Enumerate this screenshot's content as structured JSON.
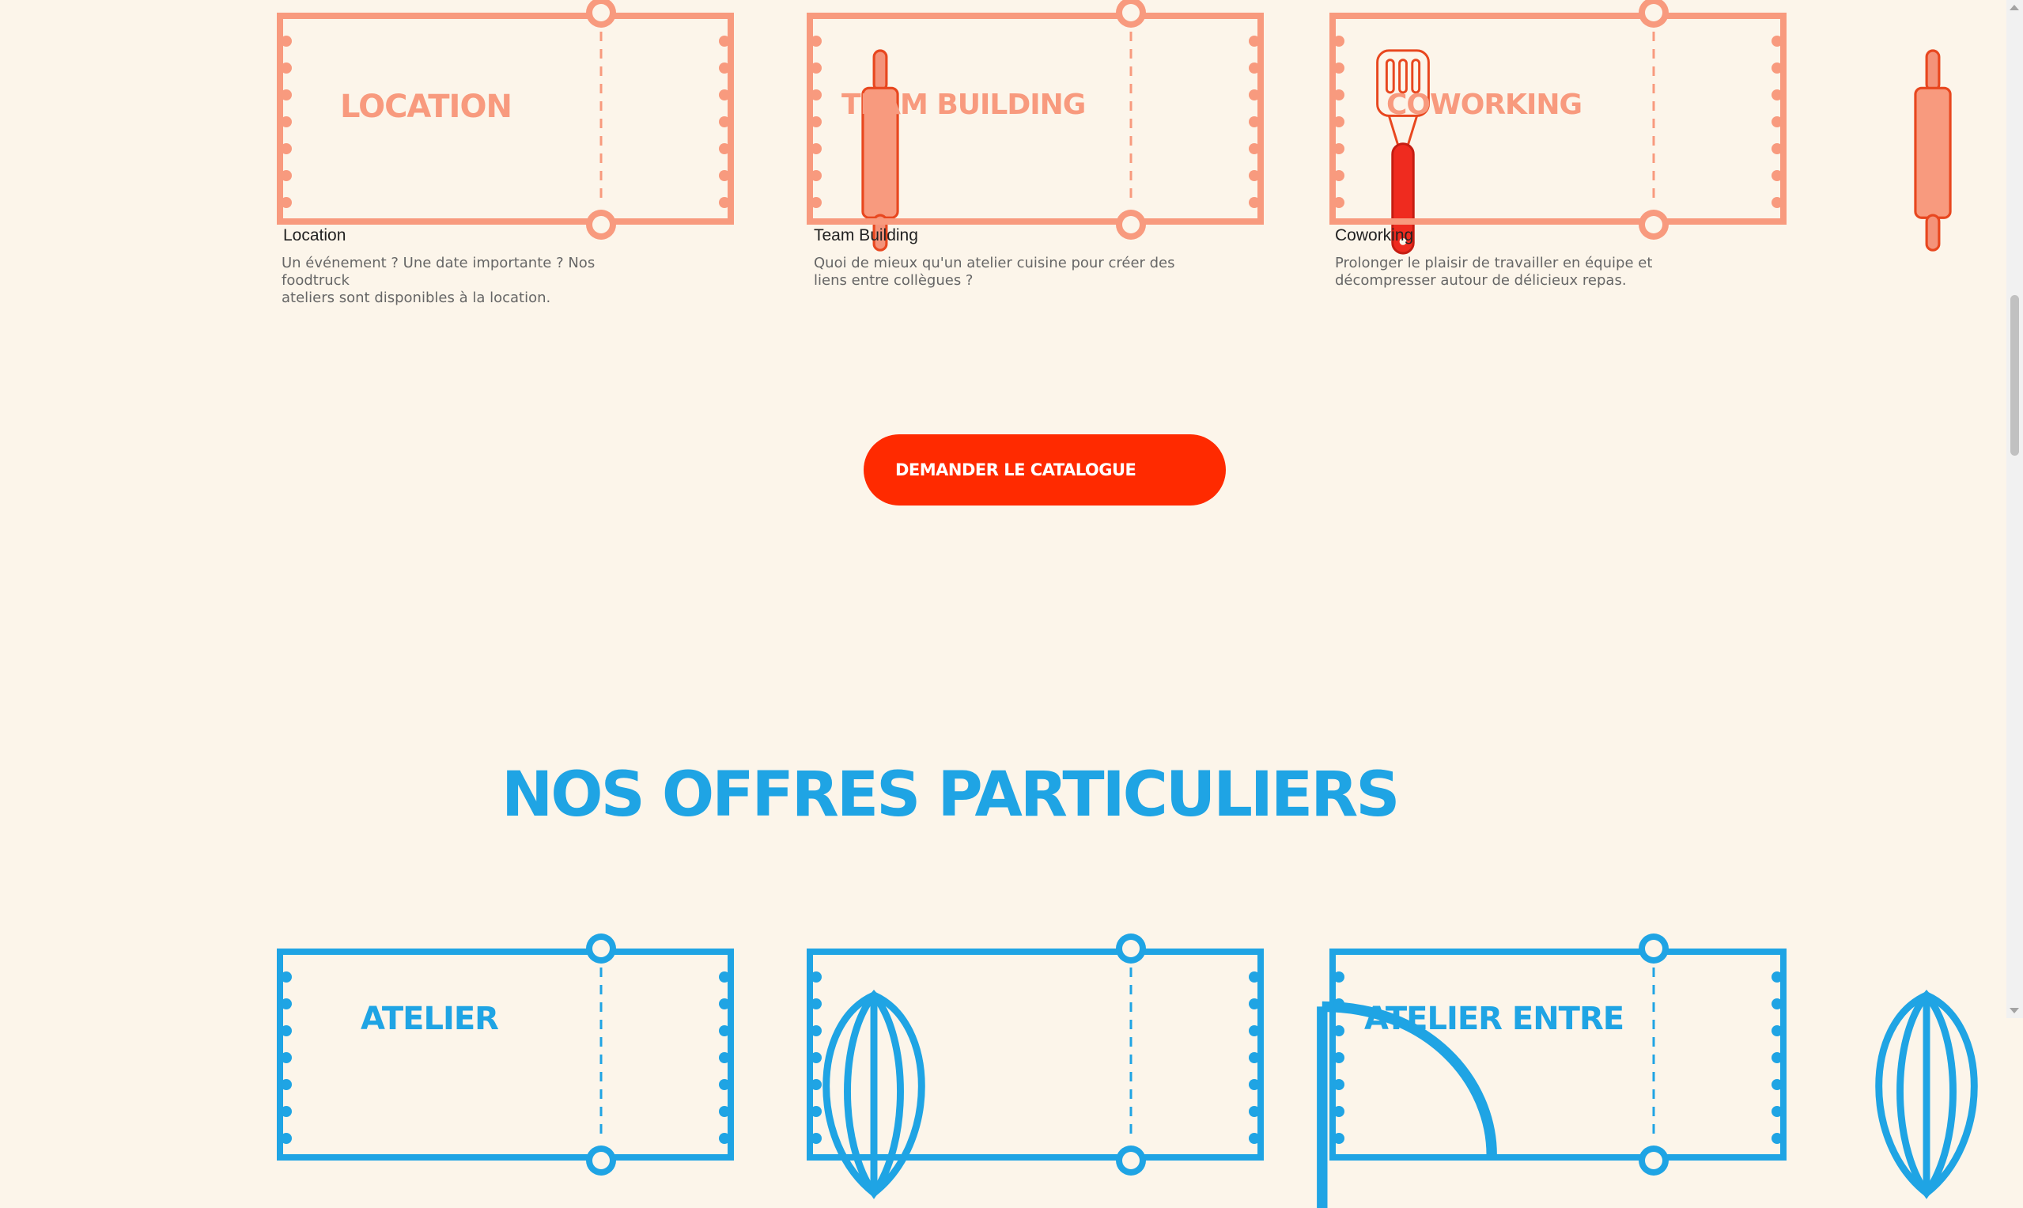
{
  "colors": {
    "salmon": "#f89a7e",
    "red": "#ff2a00",
    "blue": "#1fa4e4",
    "background": "#fcf5ea"
  },
  "pro_cards": [
    {
      "ticket_label": "LOCATION",
      "title": "Location",
      "desc_line1": "Un événement ? Une date importante ? Nos foodtruck",
      "desc_line2": "ateliers sont disponibles à la location.",
      "icon": "rolling-pin-icon"
    },
    {
      "ticket_label": "TEAM BUILDING",
      "title": "Team Building",
      "desc_line1": "Quoi de mieux qu'un atelier cuisine pour créer des",
      "desc_line2": "liens entre collègues ?",
      "icon": "spatula-icon"
    },
    {
      "ticket_label": "COWORKING",
      "title": "Coworking",
      "desc_line1": "Prolonger le plaisir de travailler en équipe et",
      "desc_line2": "décompresser autour de délicieux repas.",
      "icon": "rolling-pin-icon"
    }
  ],
  "cta": {
    "label": "DEMANDER LE CATALOGUE"
  },
  "particuliers": {
    "title": "NOS OFFRES PARTICULIERS",
    "cards": [
      {
        "ticket_label": "ATELIER",
        "icon": "whisk-icon"
      },
      {
        "ticket_label": "",
        "icon": "spoon-icon"
      },
      {
        "ticket_label": "ATELIER ENTRE",
        "icon": "whisk-icon"
      }
    ]
  }
}
